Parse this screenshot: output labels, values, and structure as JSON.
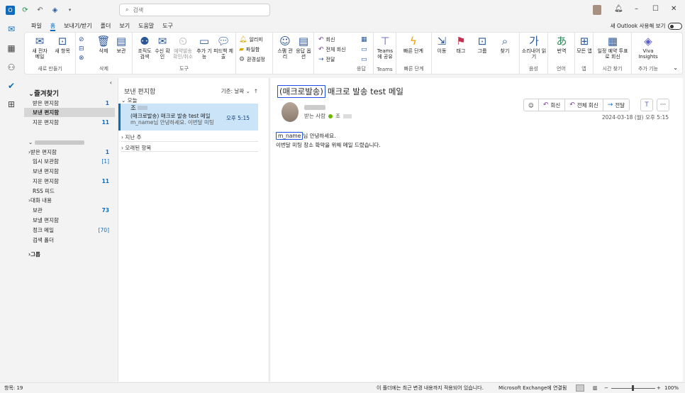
{
  "titlebar": {
    "search_placeholder": "검색",
    "new_outlook_label": "새 Outlook 사용해 보기",
    "toggle_label": "끔"
  },
  "menu": [
    "파일",
    "홈",
    "보내기/받기",
    "폴더",
    "보기",
    "도움말",
    "도구"
  ],
  "ribbon": {
    "new_mail": "새 전자 메일",
    "new_items": "새 항목",
    "group_new": "새로 만들기",
    "delete": "삭제",
    "archive": "보관",
    "group_delete": "삭제",
    "org_inspect": "조직도 검색",
    "read_confirm": "수신 확인",
    "schedule_send": "예약발송 확인/취소",
    "add_feature": "추가 기능",
    "feedback": "피드백 제출",
    "group_tools": "도구",
    "notice": "알리미",
    "file_send": "파일함",
    "env_settings": "환경설정",
    "spam": "스팸 관리",
    "reply_opts": "응답 옵션",
    "reply": "회신",
    "reply_all": "전체 회신",
    "forward": "전달",
    "group_respond": "응답",
    "teams_share": "Teams에 공유",
    "group_teams": "Teams",
    "quick_steps": "빠른 단계",
    "group_quick": "빠른 단계",
    "move": "이동",
    "tags": "태그",
    "group": "그룹",
    "find": "찾기",
    "read_aloud": "소리내어 읽기",
    "group_voice": "음성",
    "translate": "번역",
    "group_lang": "언어",
    "all_apps": "모든 앱",
    "group_apps": "앱",
    "reply_schedule": "일정 예약 투표로 회신",
    "group_time": "시간 찾기",
    "viva": "Viva Insights",
    "group_addin": "추가 기능"
  },
  "folders": {
    "favorites_label": "즐겨찾기",
    "favorites": [
      {
        "label": "받은 편지함",
        "count": "1"
      },
      {
        "label": "보낸 편지함",
        "count": ""
      },
      {
        "label": "지운 편지함",
        "count": "11"
      }
    ],
    "account_items": [
      {
        "label": "받은 편지함",
        "count": "1"
      },
      {
        "label": "임시 보관함",
        "count": "[1]"
      },
      {
        "label": "보낸 편지함",
        "count": ""
      },
      {
        "label": "지운 편지함",
        "count": "11"
      },
      {
        "label": "RSS 피드",
        "count": ""
      },
      {
        "label": "대화 내용",
        "count": ""
      },
      {
        "label": "보관",
        "count": "73"
      },
      {
        "label": "보낼 편지함",
        "count": ""
      },
      {
        "label": "정크 메일",
        "count": "[70]"
      },
      {
        "label": "검색 폴더",
        "count": ""
      }
    ],
    "groups_label": "그룹"
  },
  "message_list": {
    "title": "보낸 편지함",
    "sort_label": "기준: 날짜",
    "group_today": "오늘",
    "group_last_week": "지난 주",
    "group_older": "오래된 항목",
    "selected": {
      "to": "조",
      "subject": "(매크로발송) 매크로 발송 test 메일",
      "preview": "m_name님 안녕하세요.  이번달 미팅",
      "time": "오후 5:15"
    }
  },
  "reader": {
    "subject_tag": "(매크로발송)",
    "subject_rest": "매크로 발송 test 메일",
    "to_label": "받는 사람",
    "to_name": "조",
    "reply": "회신",
    "reply_all": "전체 회신",
    "forward": "전달",
    "date": "2024-03-18 (월) 오후 5:15",
    "body_name": "m_name",
    "body_line1_rest": "님 안녕하세요.",
    "body_line2": "이번달 미팅 장소 확약을 위해 메일 드렸습니다."
  },
  "status": {
    "items": "항목: 19",
    "notice": "이 폴더에는 최근 변경 내용까지 적용되어 있습니다.",
    "connection": "Microsoft Exchange에 연결됨",
    "zoom": "100%"
  }
}
